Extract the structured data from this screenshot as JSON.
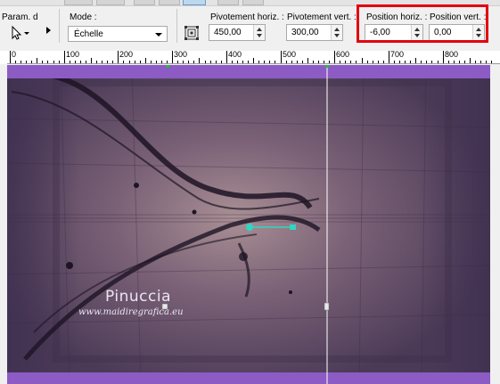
{
  "toolbar": {
    "param_label": "Param. d",
    "mode_label": "Mode :",
    "mode_value": "Échelle",
    "pivot_h_label": "Pivotement horiz. :",
    "pivot_h_value": "450,00",
    "pivot_v_label": "Pivotement vert. :",
    "pivot_v_value": "300,00",
    "pos_h_label": "Position horiz. :",
    "pos_h_value": "-6,00",
    "pos_v_label": "Position vert. :",
    "pos_v_value": "0,00",
    "highlight_color": "#e3000f"
  },
  "ruler": {
    "labels": [
      "0",
      "100",
      "200",
      "300",
      "400",
      "500",
      "600",
      "700",
      "800"
    ]
  },
  "canvas": {
    "band_color": "#8c5bc4",
    "guide_color": "#ffffff",
    "handle_color": "#2fd6c3",
    "watermark_title": "Pinuccia",
    "watermark_url": "www.maidiregrafica.eu"
  }
}
